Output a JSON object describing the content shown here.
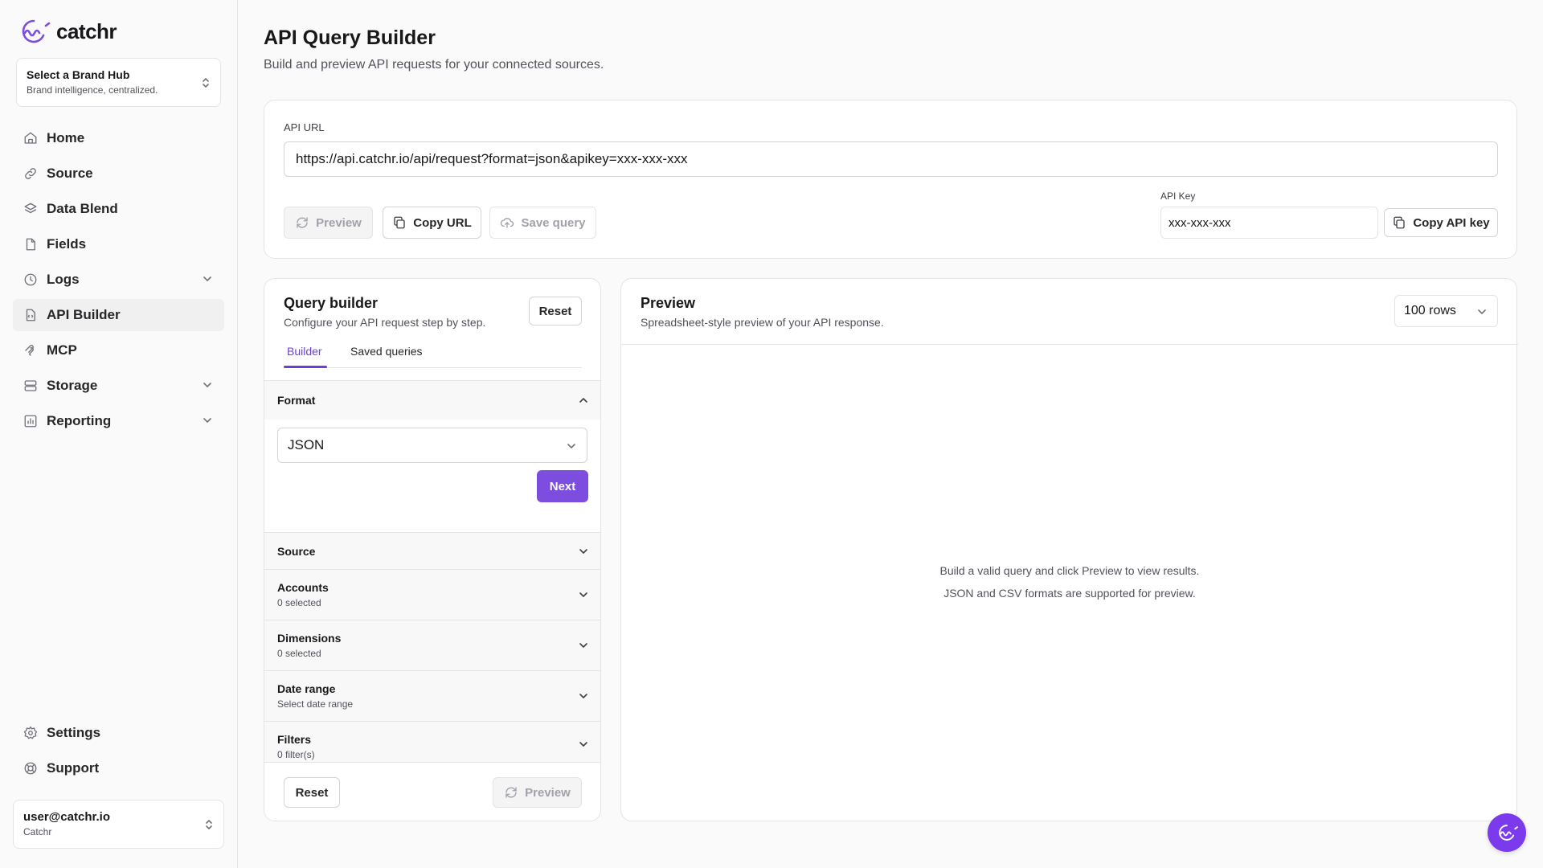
{
  "app": {
    "logo_text": "catchr",
    "accent": "#7c4dde"
  },
  "brand_hub": {
    "title": "Select a Brand Hub",
    "subtitle": "Brand intelligence, centralized."
  },
  "nav": {
    "items": [
      {
        "label": "Home",
        "icon": "home-icon"
      },
      {
        "label": "Source",
        "icon": "link-icon"
      },
      {
        "label": "Data Blend",
        "icon": "layers-icon"
      },
      {
        "label": "Fields",
        "icon": "file-icon"
      },
      {
        "label": "Logs",
        "icon": "clock-icon",
        "expandable": true
      },
      {
        "label": "API Builder",
        "icon": "file-code-icon",
        "active": true
      },
      {
        "label": "MCP",
        "icon": "mcp-icon"
      },
      {
        "label": "Storage",
        "icon": "database-icon",
        "expandable": true
      },
      {
        "label": "Reporting",
        "icon": "chart-icon",
        "expandable": true
      }
    ],
    "bottom": [
      {
        "label": "Settings",
        "icon": "gear-icon"
      },
      {
        "label": "Support",
        "icon": "lifebuoy-icon"
      }
    ]
  },
  "user": {
    "email": "user@catchr.io",
    "org": "Catchr"
  },
  "page": {
    "title": "API Query Builder",
    "subtitle": "Build and preview API requests for your connected sources."
  },
  "url_card": {
    "label": "API URL",
    "url": "https://api.catchr.io/api/request?format=json&apikey=xxx-xxx-xxx",
    "preview_label": "Preview",
    "copy_url_label": "Copy URL",
    "save_query_label": "Save query",
    "api_key_label": "API Key",
    "api_key_value": "xxx-xxx-xxx",
    "copy_api_key_label": "Copy API key"
  },
  "query_builder": {
    "title": "Query builder",
    "subtitle": "Configure your API request step by step.",
    "reset_label": "Reset",
    "tabs": [
      "Builder",
      "Saved queries"
    ],
    "format": {
      "title": "Format",
      "selected": "JSON",
      "next_label": "Next"
    },
    "sections": [
      {
        "title": "Source",
        "subtitle": ""
      },
      {
        "title": "Accounts",
        "subtitle": "0 selected"
      },
      {
        "title": "Dimensions",
        "subtitle": "0 selected"
      },
      {
        "title": "Date range",
        "subtitle": "Select date range"
      },
      {
        "title": "Filters",
        "subtitle": "0 filter(s)"
      }
    ],
    "footer": {
      "reset_label": "Reset",
      "preview_label": "Preview"
    }
  },
  "preview": {
    "title": "Preview",
    "subtitle": "Spreadsheet-style preview of your API response.",
    "rows_selected": "100 rows",
    "empty_line1": "Build a valid query and click Preview to view results.",
    "empty_line2": "JSON and CSV formats are supported for preview."
  }
}
